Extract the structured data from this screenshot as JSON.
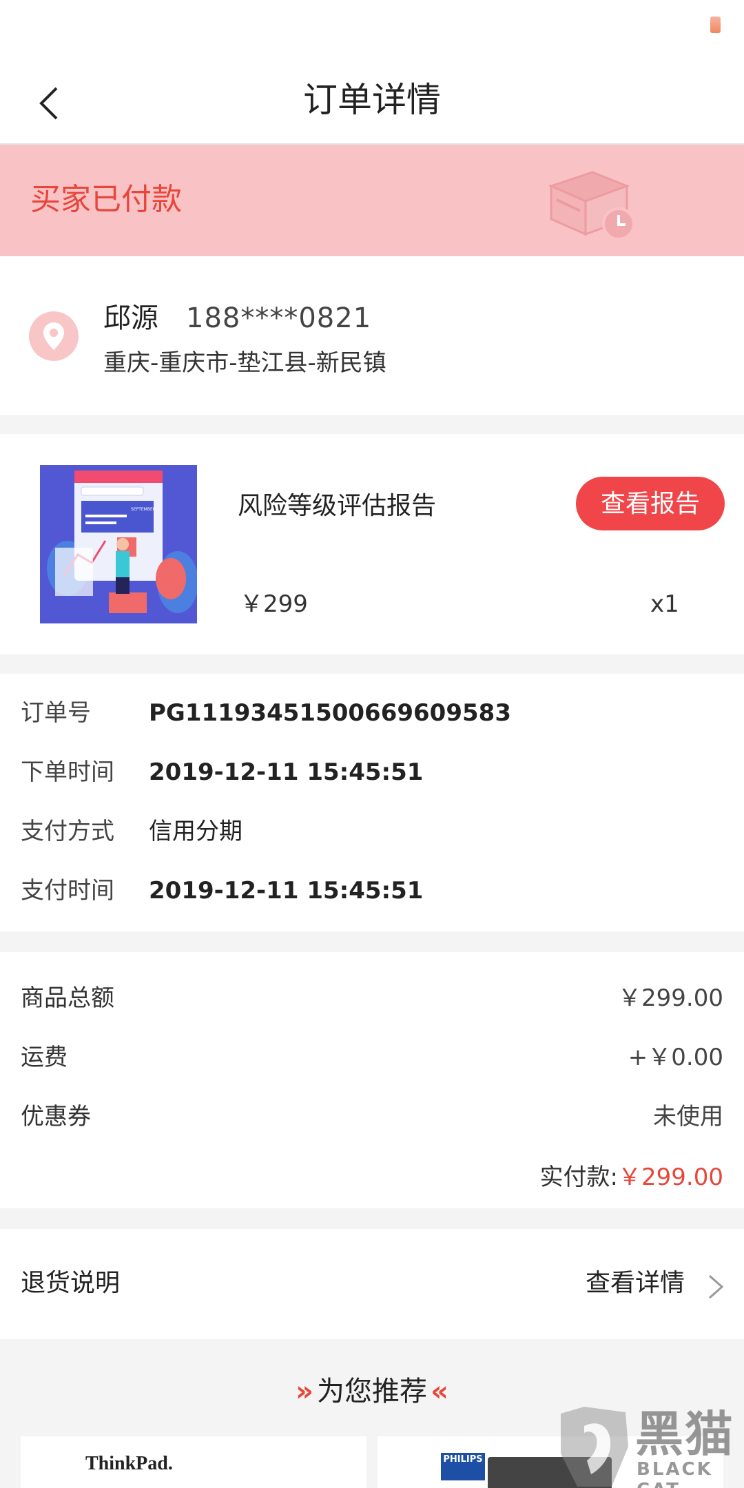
{
  "header": {
    "title": "订单详情"
  },
  "banner": {
    "status": "买家已付款"
  },
  "address": {
    "name": "邱源",
    "phone": "188****0821",
    "line": "重庆-重庆市-垫江县-新民镇"
  },
  "product": {
    "name": "风险等级评估报告",
    "button": "查看报告",
    "price": "￥299",
    "qty": "x1",
    "thumb_caption": "SEPTEMBER"
  },
  "order": {
    "rows": [
      {
        "label": "订单号",
        "value": "PG11193451500669609583"
      },
      {
        "label": "下单时间",
        "value": "2019-12-11 15:45:51"
      },
      {
        "label": "支付方式",
        "value": "信用分期"
      },
      {
        "label": "支付时间",
        "value": "2019-12-11 15:45:51"
      }
    ]
  },
  "amounts": {
    "rows": [
      {
        "label": "商品总额",
        "value": "￥299.00"
      },
      {
        "label": "运费",
        "value": "+￥0.00"
      },
      {
        "label": "优惠券",
        "value": "未使用"
      }
    ],
    "paid_label": "实付款:",
    "paid_value": "￥299.00"
  },
  "returns": {
    "label": "退货说明",
    "link": "查看详情"
  },
  "recommend": {
    "title": "为您推荐",
    "arrow_left": "»",
    "arrow_right": "«",
    "card1_brand": "ThinkPad.",
    "card2_brand": "PHILIPS"
  },
  "watermark": {
    "cn": "黑猫",
    "en": "BLACK CAT"
  },
  "colors": {
    "accent": "#f0464a",
    "banner_bg": "#f9c3c6",
    "status_text": "#e8463a"
  }
}
